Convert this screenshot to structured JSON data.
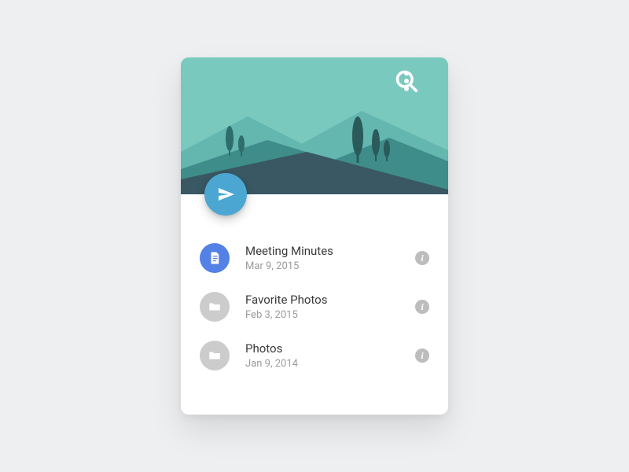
{
  "colors": {
    "fab": "#4ba7d1",
    "doc_avatar": "#5481e6",
    "folder_avatar": "#cccccc",
    "info": "#bdbdbd"
  },
  "items": [
    {
      "icon": "doc",
      "title": "Meeting Minutes",
      "subtitle": "Mar 9, 2015"
    },
    {
      "icon": "folder",
      "title": "Favorite Photos",
      "subtitle": "Feb 3, 2015"
    },
    {
      "icon": "folder",
      "title": "Photos",
      "subtitle": "Jan 9, 2014"
    }
  ]
}
